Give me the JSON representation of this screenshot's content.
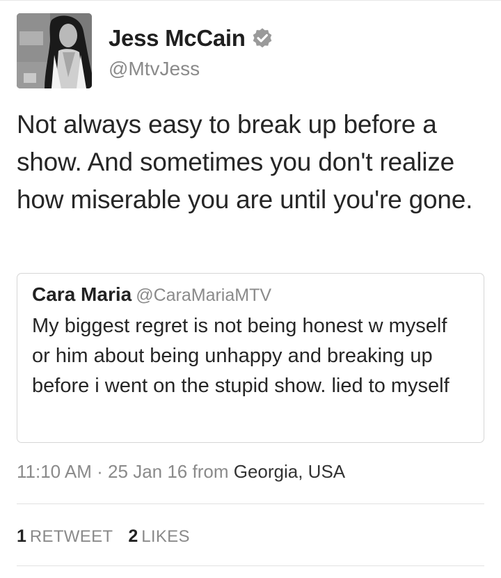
{
  "tweet": {
    "author": {
      "display_name": "Jess McCain",
      "handle": "@MtvJess",
      "verified": true
    },
    "text": "Not always easy to break up before a show. And sometimes you don't realize how miserable you are until you're gone.",
    "quoted_tweet": {
      "display_name": "Cara Maria",
      "handle": "@CaraMariaMTV",
      "text": "My biggest regret is not being honest w myself or him about being unhappy and breaking up before i went on the stupid show. lied to myself"
    },
    "meta": {
      "time": "11:10 AM",
      "separator": " · ",
      "date": "25 Jan 16",
      "from_label": "from",
      "location": "Georgia, USA"
    },
    "stats": {
      "retweets_count": "1",
      "retweets_label": "RETWEET",
      "likes_count": "2",
      "likes_label": "LIKES"
    }
  },
  "icons": {
    "verified": "verified-badge-icon"
  },
  "colors": {
    "text": "#262626",
    "muted": "#8a8a8a",
    "border": "#d6d6d6",
    "divider": "#e1e1e1"
  }
}
